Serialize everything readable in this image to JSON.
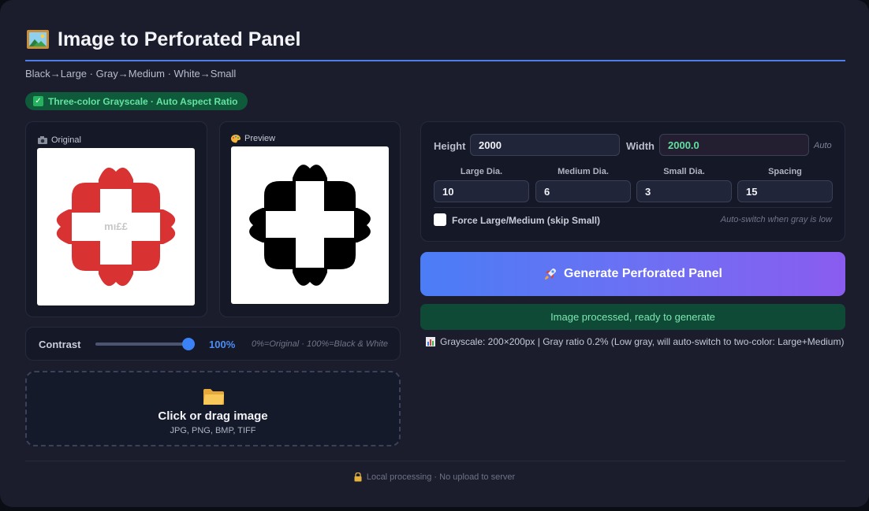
{
  "header": {
    "title": "Image to Perforated Panel",
    "subtitle": "Black→Large · Gray→Medium · White→Small",
    "badge": "Three-color Grayscale · Auto Aspect Ratio",
    "logo_icon": "picture-frame-icon"
  },
  "original_card": {
    "label": "Original",
    "icon": "camera-icon",
    "image_text": "mı££"
  },
  "preview_card": {
    "label": "Preview",
    "icon": "palette-icon"
  },
  "contrast": {
    "label": "Contrast",
    "value_text": "100%",
    "value": 1.0,
    "hint": "0%=Original · 100%=Black & White"
  },
  "dropzone": {
    "icon": "folder-icon",
    "title": "Click or drag image",
    "formats": "JPG, PNG, BMP, TIFF"
  },
  "settings": {
    "height_label": "Height",
    "height_value": "2000",
    "width_label": "Width",
    "width_value": "2000.0",
    "auto_label": "Auto",
    "large_label": "Large Dia.",
    "large_value": "10",
    "medium_label": "Medium Dia.",
    "medium_value": "6",
    "small_label": "Small Dia.",
    "small_value": "3",
    "spacing_label": "Spacing",
    "spacing_value": "15",
    "force_label": "Force Large/Medium (skip Small)",
    "force_checked": false,
    "force_hint": "Auto-switch when gray is low"
  },
  "generate_button": {
    "label": "Generate Perforated Panel",
    "icon": "rocket-icon"
  },
  "status_text": "Image processed, ready to generate",
  "info": {
    "icon": "bar-chart-icon",
    "text": "Grayscale: 200×200px | Gray ratio 0.2% (Low gray, will auto-switch to two-color: Large+Medium)"
  },
  "footer": {
    "icon": "lock-icon",
    "text": "Local processing · No upload to server"
  },
  "colors": {
    "accent": "#4d7ef0",
    "badge_text": "#62e3a1",
    "logo_red": "#d93232",
    "status_bg": "#0e4a35"
  }
}
